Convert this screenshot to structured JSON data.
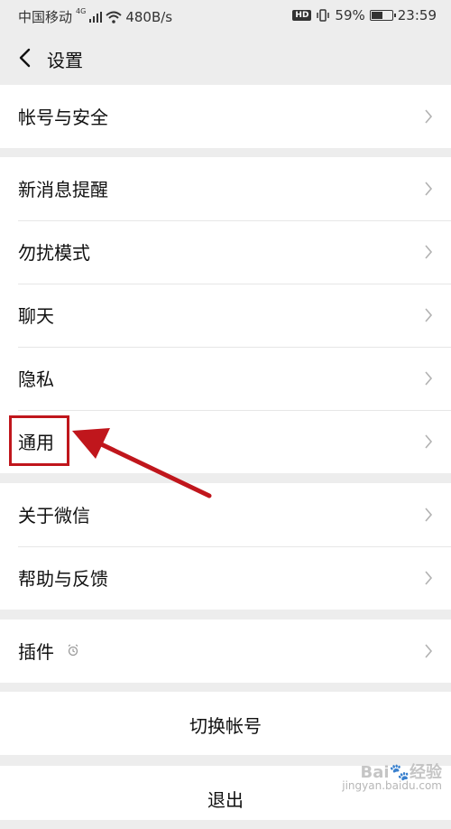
{
  "status_bar": {
    "carrier": "中国移动",
    "network": "4G",
    "speed": "480B/s",
    "hd": "HD",
    "battery_pct": "59%",
    "battery_level": 0.59,
    "time": "23:59"
  },
  "nav": {
    "title": "设置"
  },
  "groups": [
    {
      "items": [
        {
          "label": "帐号与安全"
        }
      ]
    },
    {
      "items": [
        {
          "label": "新消息提醒"
        },
        {
          "label": "勿扰模式"
        },
        {
          "label": "聊天"
        },
        {
          "label": "隐私"
        },
        {
          "label": "通用"
        }
      ]
    },
    {
      "items": [
        {
          "label": "关于微信"
        },
        {
          "label": "帮助与反馈"
        }
      ]
    },
    {
      "items": [
        {
          "label": "插件"
        }
      ]
    }
  ],
  "actions": {
    "switch_account": "切换帐号",
    "logout": "退出"
  },
  "watermark": {
    "logo": "Bai🐾经验",
    "url": "jingyan.baidu.com"
  },
  "colors": {
    "annotation_red": "#c0161c",
    "background": "#ededed",
    "row_bg": "#ffffff"
  }
}
